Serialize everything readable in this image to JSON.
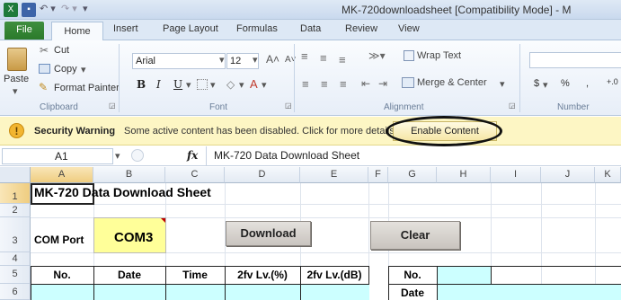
{
  "window": {
    "title": "MK-720downloadsheet  [Compatibility Mode]  -  M"
  },
  "tabs": {
    "file": "File",
    "home": "Home",
    "insert": "Insert",
    "page_layout": "Page Layout",
    "formulas": "Formulas",
    "data": "Data",
    "review": "Review",
    "view": "View"
  },
  "ribbon": {
    "clipboard": {
      "label": "Clipboard",
      "paste": "Paste",
      "cut": "Cut",
      "copy": "Copy",
      "format_painter": "Format Painter"
    },
    "font": {
      "label": "Font",
      "name": "Arial",
      "size": "12"
    },
    "alignment": {
      "label": "Alignment",
      "wrap_text": "Wrap Text",
      "merge_center": "Merge & Center"
    },
    "number": {
      "label": "Number",
      "currency": "$",
      "percent": "%",
      "comma": ",",
      "increase_decimal": "+.0"
    }
  },
  "security": {
    "title": "Security Warning",
    "message": "Some active content has been disabled. Click for more details.",
    "button": "Enable Content"
  },
  "formula_bar": {
    "name_box": "A1",
    "fx": "fx",
    "value": "MK-720 Data Download Sheet"
  },
  "grid": {
    "columns": [
      "A",
      "B",
      "C",
      "D",
      "E",
      "F",
      "G",
      "H",
      "I",
      "J",
      "K"
    ],
    "rows": [
      "1",
      "2",
      "3",
      "4",
      "5",
      "6"
    ],
    "title": "MK-720 Data Download Sheet",
    "com_port_label": "COM Port",
    "com_port_value": "COM3",
    "download_button": "Download",
    "clear_button": "Clear",
    "headers": [
      "No.",
      "Date",
      "Time",
      "2fv Lv.(%)",
      "2fv Lv.(dB)"
    ],
    "side_no": "No.",
    "side_date": "Date"
  },
  "colors": {
    "input_cell": "#ccffff",
    "com_cell": "#ffff99",
    "warning_bar": "#fdf6c4",
    "file_tab": "#2b7a2b"
  }
}
